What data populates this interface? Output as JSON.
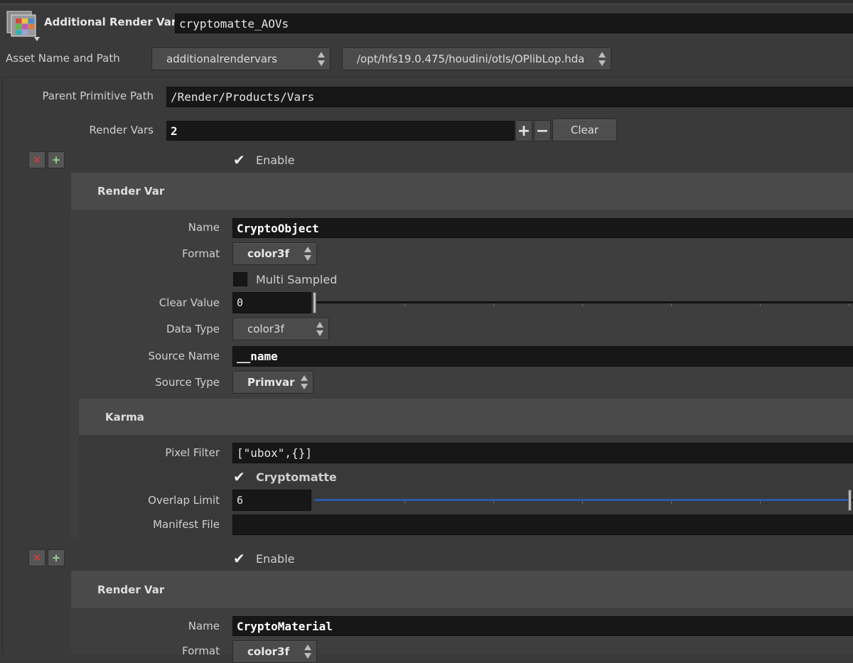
{
  "node": {
    "type_label": "Additional Render Vars",
    "name": "cryptomatte_AOVs",
    "icon": "additional-render-vars-icon"
  },
  "asset": {
    "label": "Asset Name and Path",
    "name": "additionalrendervars",
    "path": "/opt/hfs19.0.475/houdini/otls/OPlibLop.hda"
  },
  "parent_path": {
    "label": "Parent Primitive Path",
    "value": "/Render/Products/Vars"
  },
  "render_vars": {
    "label": "Render Vars",
    "count": "2",
    "plus": "+",
    "minus": "−",
    "clear_label": "Clear"
  },
  "vars": [
    {
      "enable_label": "Enable",
      "section_title": "Render Var",
      "name": {
        "label": "Name",
        "value": "CryptoObject"
      },
      "format": {
        "label": "Format",
        "value": "color3f"
      },
      "multi_sampled": {
        "label": "Multi Sampled",
        "checked": false
      },
      "clear_value": {
        "label": "Clear Value",
        "value": "0"
      },
      "data_type": {
        "label": "Data Type",
        "value": "color3f"
      },
      "source_name": {
        "label": "Source Name",
        "value": "__name"
      },
      "source_type": {
        "label": "Source Type",
        "value": "Primvar"
      },
      "karma": {
        "title": "Karma",
        "pixel_filter": {
          "label": "Pixel Filter",
          "value": "[\"ubox\",{}]"
        },
        "cryptomatte": {
          "label": "Cryptomatte",
          "checked": true
        },
        "overlap_limit": {
          "label": "Overlap Limit",
          "value": "6",
          "level": 1.0
        },
        "manifest_file": {
          "label": "Manifest File",
          "value": ""
        }
      }
    },
    {
      "enable_label": "Enable",
      "section_title": "Render Var",
      "name": {
        "label": "Name",
        "value": "CryptoMaterial"
      },
      "format": {
        "label": "Format",
        "value": "color3f"
      }
    }
  ],
  "colors": {
    "background": "#3a3a3a",
    "field": "#171717",
    "header": "#4a4a4a",
    "slider_fill": "#2b5aa8",
    "delete_icon": "#d03030",
    "add_icon": "#8fd08f"
  }
}
